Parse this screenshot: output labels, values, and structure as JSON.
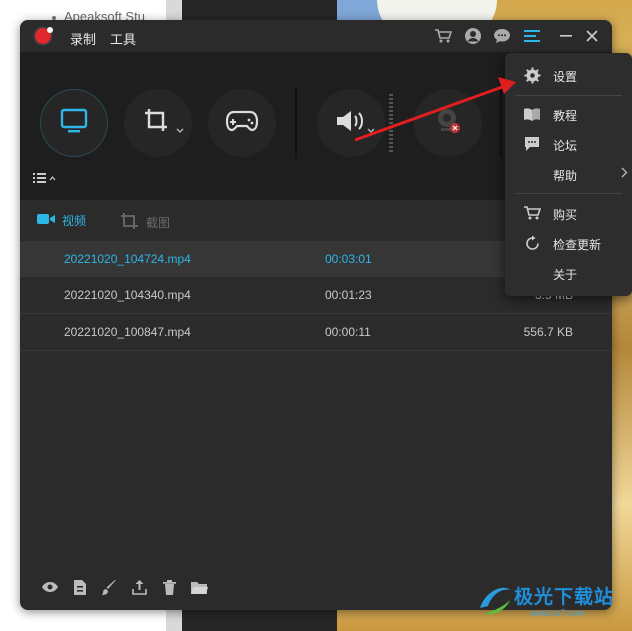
{
  "background": {
    "left_text": "Apeaksoft Stu"
  },
  "titlebar": {
    "menu_record": "录制",
    "menu_tools": "工具",
    "icons": [
      "cart-icon",
      "user-icon",
      "chat-icon",
      "menu-icon",
      "minimize-icon",
      "close-icon"
    ]
  },
  "toolbar": {
    "buttons": [
      "screen-record",
      "crop-region",
      "game-record",
      "audio-system",
      "webcam"
    ]
  },
  "tabs": {
    "video": "视频",
    "screenshot": "截图"
  },
  "files": [
    {
      "name": "20221020_104724.mp4",
      "duration": "00:03:01",
      "size": "",
      "selected": true
    },
    {
      "name": "20221020_104340.mp4",
      "duration": "00:01:23",
      "size": "3.5 MB",
      "selected": false
    },
    {
      "name": "20221020_100847.mp4",
      "duration": "00:00:11",
      "size": "556.7 KB",
      "selected": false
    }
  ],
  "dropdown": {
    "settings": "设置",
    "tutorial": "教程",
    "forum": "论坛",
    "help": "帮助",
    "buy": "购买",
    "check_update": "检查更新",
    "about": "关于"
  },
  "watermark": {
    "text": "极光下载站",
    "url": "www.xz7.com"
  },
  "colors": {
    "accent": "#2fb6e8",
    "record_red": "#e0282d",
    "arrow_red": "#e01e1e"
  }
}
